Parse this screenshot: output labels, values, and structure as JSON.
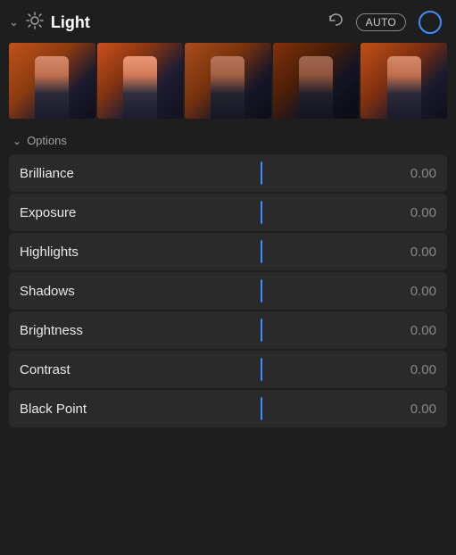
{
  "header": {
    "title": "Light",
    "auto_label": "AUTO",
    "chevron": "chevron",
    "sun": "sun"
  },
  "options": {
    "label": "Options"
  },
  "sliders": [
    {
      "label": "Brilliance",
      "value": "0.00"
    },
    {
      "label": "Exposure",
      "value": "0.00"
    },
    {
      "label": "Highlights",
      "value": "0.00"
    },
    {
      "label": "Shadows",
      "value": "0.00"
    },
    {
      "label": "Brightness",
      "value": "0.00"
    },
    {
      "label": "Contrast",
      "value": "0.00"
    },
    {
      "label": "Black Point",
      "value": "0.00"
    }
  ]
}
